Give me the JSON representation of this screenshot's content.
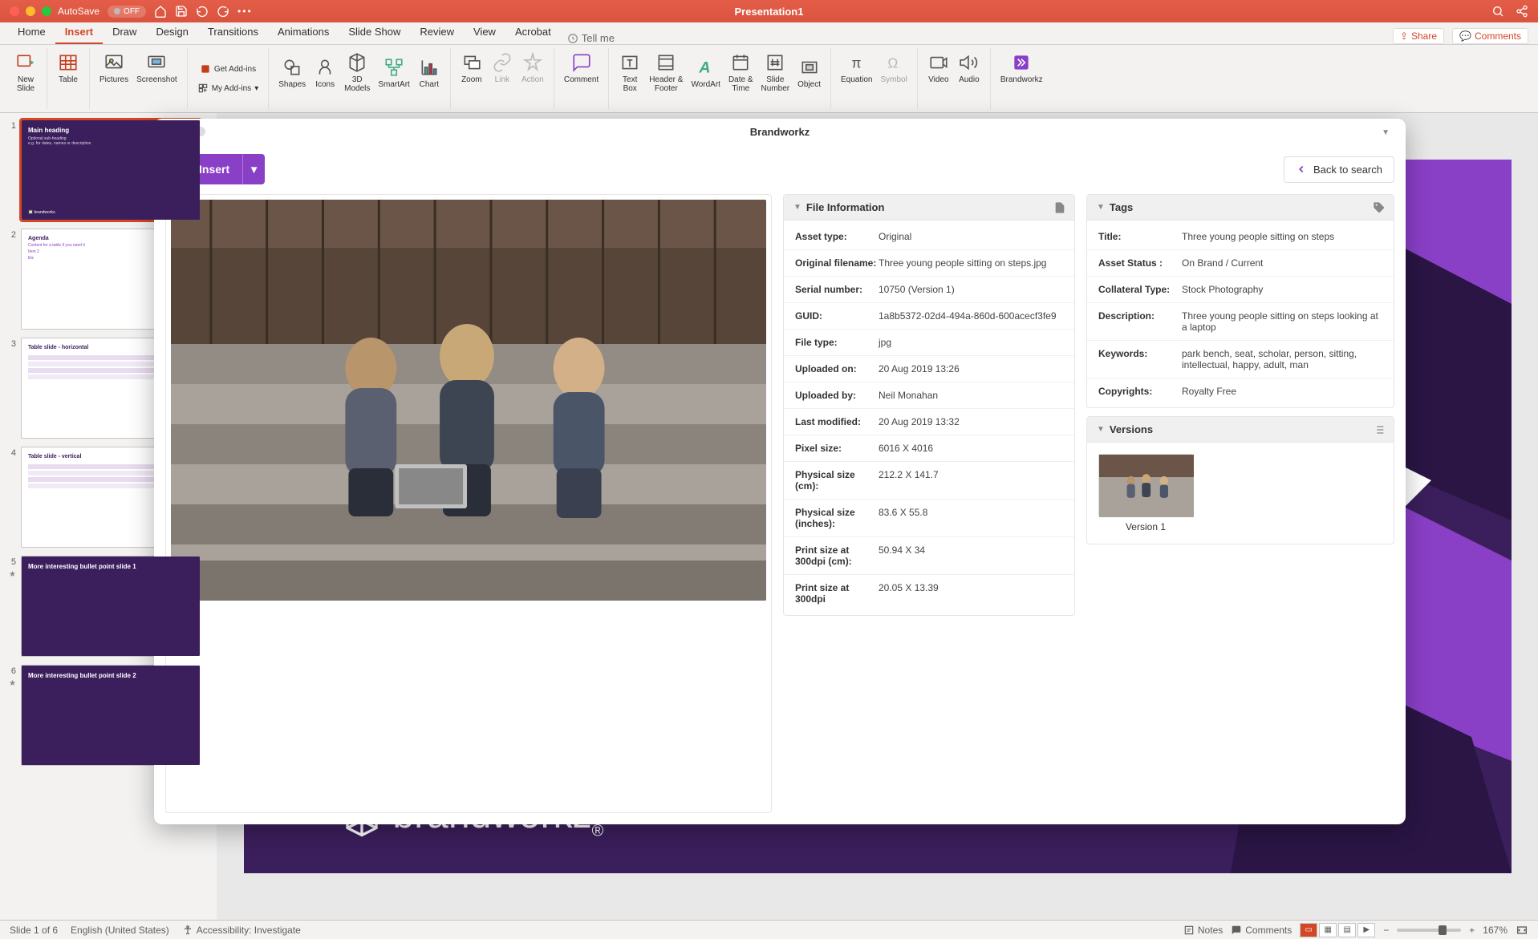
{
  "titlebar": {
    "autosave_label": "AutoSave",
    "autosave_state": "OFF",
    "doc_title": "Presentation1"
  },
  "ribbon_tabs": [
    "Home",
    "Insert",
    "Draw",
    "Design",
    "Transitions",
    "Animations",
    "Slide Show",
    "Review",
    "View",
    "Acrobat"
  ],
  "active_tab_index": 1,
  "tellme": "Tell me",
  "share_btn": "Share",
  "comments_btn": "Comments",
  "ribbon": {
    "new_slide": "New\nSlide",
    "table": "Table",
    "pictures": "Pictures",
    "screenshot": "Screenshot",
    "get_addins": "Get Add-ins",
    "my_addins": "My Add-ins",
    "shapes": "Shapes",
    "icons": "Icons",
    "models": "3D\nModels",
    "smartart": "SmartArt",
    "chart": "Chart",
    "zoom": "Zoom",
    "link": "Link",
    "action": "Action",
    "comment": "Comment",
    "textbox": "Text\nBox",
    "header_footer": "Header &\nFooter",
    "wordart": "WordArt",
    "date_time": "Date &\nTime",
    "slide_number": "Slide\nNumber",
    "object": "Object",
    "equation": "Equation",
    "symbol": "Symbol",
    "video": "Video",
    "audio": "Audio",
    "brandworkz": "Brandworkz"
  },
  "thumbs": [
    {
      "num": "1",
      "title": "Main heading",
      "sub": "Optional sub-heading\ne.g. for dates, names or description",
      "footer": "brandworkz.",
      "dark": true
    },
    {
      "num": "2",
      "title": "Agenda",
      "lines": [
        "Content for a table if you need it",
        "Item 2",
        "Etc"
      ],
      "dark": false
    },
    {
      "num": "3",
      "title": "Table slide - horizontal",
      "dark": false
    },
    {
      "num": "4",
      "title": "Table slide - vertical",
      "dark": false
    },
    {
      "num": "5",
      "title": "More interesting bullet point slide 1",
      "dark": true,
      "star": true
    },
    {
      "num": "6",
      "title": "More interesting bullet point slide 2",
      "dark": true,
      "star": true
    }
  ],
  "main_slide": {
    "logo_text": "brandworkz",
    "logo_r": "®"
  },
  "bw": {
    "panel_title": "Brandworkz",
    "insert_btn": "Insert",
    "back_btn": "Back to search",
    "file_info_header": "File Information",
    "tags_header": "Tags",
    "versions_header": "Versions",
    "file_info": [
      {
        "label": "Asset type:",
        "value": "Original"
      },
      {
        "label": "Original filename:",
        "value": "Three young people sitting on steps.jpg"
      },
      {
        "label": "Serial number:",
        "value": "10750 (Version 1)"
      },
      {
        "label": "GUID:",
        "value": "1a8b5372-02d4-494a-860d-600acecf3fe9"
      },
      {
        "label": "File type:",
        "value": "jpg"
      },
      {
        "label": "Uploaded on:",
        "value": "20 Aug 2019 13:26"
      },
      {
        "label": "Uploaded by:",
        "value": "Neil Monahan"
      },
      {
        "label": "Last modified:",
        "value": "20 Aug 2019 13:32"
      },
      {
        "label": "Pixel size:",
        "value": "6016 X 4016"
      },
      {
        "label": "Physical size (cm):",
        "value": "212.2 X 141.7"
      },
      {
        "label": "Physical size (inches):",
        "value": "83.6 X 55.8"
      },
      {
        "label": "Print size at 300dpi (cm):",
        "value": "50.94 X 34"
      },
      {
        "label": "Print size at 300dpi",
        "value": "20.05 X 13.39"
      }
    ],
    "tags": [
      {
        "label": "Title:",
        "value": "Three young people sitting on steps"
      },
      {
        "label": "Asset Status :",
        "value": "On Brand / Current"
      },
      {
        "label": "Collateral Type:",
        "value": "Stock Photography"
      },
      {
        "label": "Description:",
        "value": "Three young people sitting on steps looking at a laptop"
      },
      {
        "label": "Keywords:",
        "value": "park bench, seat, scholar, person, sitting, intellectual, happy, adult, man"
      },
      {
        "label": "Copyrights:",
        "value": "Royalty Free"
      }
    ],
    "version_label": "Version 1"
  },
  "status": {
    "slide_of": "Slide 1 of 6",
    "lang": "English (United States)",
    "a11y": "Accessibility: Investigate",
    "notes": "Notes",
    "comments": "Comments",
    "zoom": "167%"
  }
}
